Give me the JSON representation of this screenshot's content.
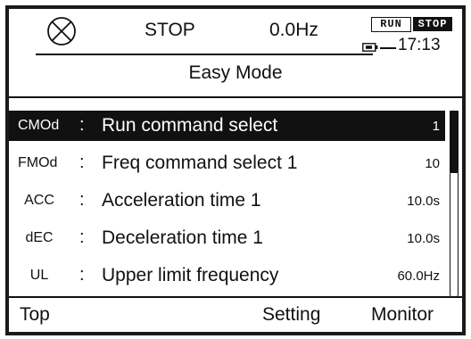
{
  "status": {
    "icon": "circle-x-icon",
    "state": "STOP",
    "frequency": "0.0Hz",
    "run_label": "RUN",
    "stop_label": "STOP",
    "battery_icon": "battery-icon",
    "time": "17:13"
  },
  "title": "Easy Mode",
  "items": [
    {
      "code": "CMOd",
      "sep": ":",
      "label": "Run command select",
      "value": "1"
    },
    {
      "code": "FMOd",
      "sep": ":",
      "label": "Freq command select 1",
      "value": "10"
    },
    {
      "code": "ACC",
      "sep": ":",
      "label": "Acceleration time 1",
      "value": "10.0s"
    },
    {
      "code": "dEC",
      "sep": ":",
      "label": "Deceleration time 1",
      "value": "10.0s"
    },
    {
      "code": "UL",
      "sep": ":",
      "label": "Upper limit frequency",
      "value": "60.0Hz"
    }
  ],
  "softkeys": {
    "left": "Top",
    "center": "Setting",
    "right": "Monitor"
  },
  "colors": {
    "foreground": "#111111",
    "background": "#ffffff",
    "selected_bg": "#111111",
    "selected_fg": "#ffffff"
  }
}
